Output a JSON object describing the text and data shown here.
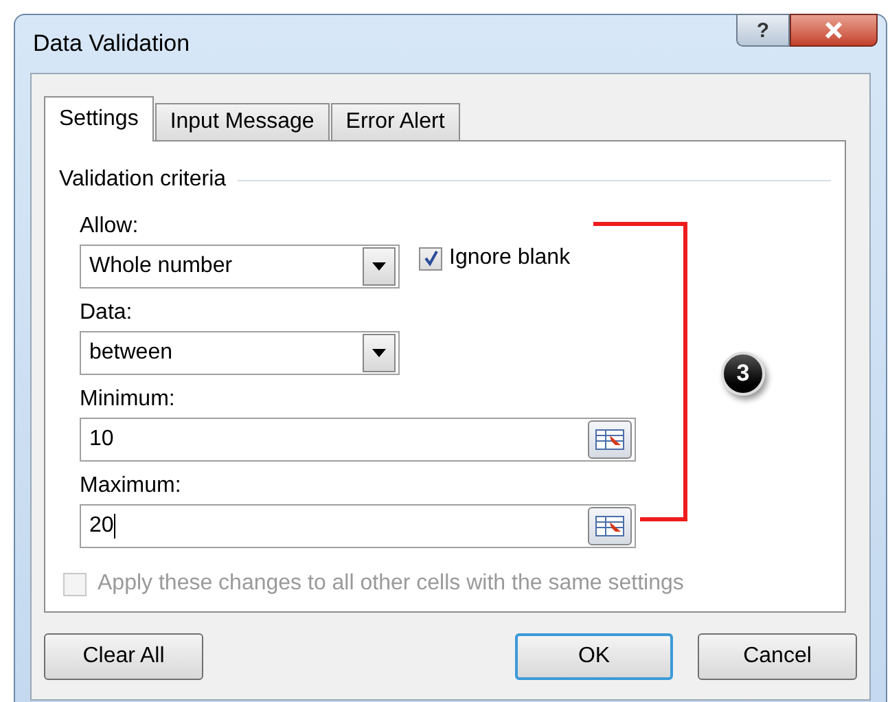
{
  "window": {
    "title": "Data Validation",
    "help_button": "?"
  },
  "tabs": [
    {
      "label": "Settings",
      "selected": true
    },
    {
      "label": "Input Message",
      "selected": false
    },
    {
      "label": "Error Alert",
      "selected": false
    }
  ],
  "section": {
    "title": "Validation criteria"
  },
  "allow": {
    "label": "Allow:",
    "value": "Whole number"
  },
  "ignore_blank": {
    "label": "Ignore blank",
    "checked": true
  },
  "data": {
    "label": "Data:",
    "value": "between"
  },
  "minimum": {
    "label": "Minimum:",
    "value": "10",
    "focused": false
  },
  "maximum": {
    "label": "Maximum:",
    "value": "20",
    "focused": true
  },
  "apply_all": {
    "label": "Apply these changes to all other cells with the same settings",
    "checked": false,
    "disabled": true
  },
  "buttons": [
    {
      "label": "Clear All",
      "default": false
    },
    {
      "label": "OK",
      "default": true
    },
    {
      "label": "Cancel",
      "default": false
    }
  ],
  "annotation": {
    "badge": "3"
  }
}
